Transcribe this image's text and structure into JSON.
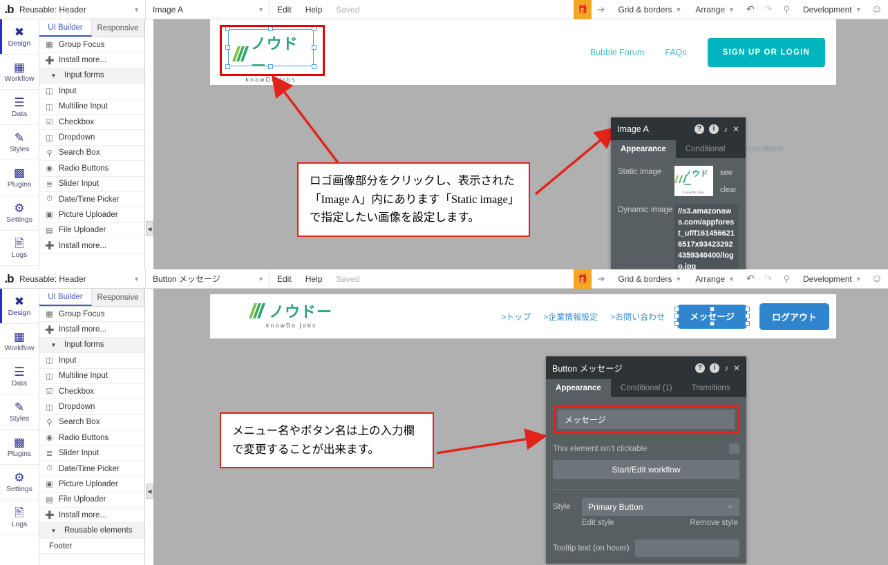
{
  "screens": [
    {
      "id": "screen-top",
      "topbar": {
        "brand": ".b",
        "page_select": "Reusable: Header",
        "element_select": "Image A",
        "edit": "Edit",
        "help": "Help",
        "saved": "Saved",
        "gift_icon": "gift-icon",
        "pointer_icon": "pointer-icon",
        "grid_borders": "Grid & borders",
        "arrange": "Arrange",
        "undo_icon": "undo-icon",
        "redo_icon": "redo-icon",
        "search_icon": "search-icon",
        "version": "Development",
        "avatar_icon": "account-icon"
      },
      "rail": [
        {
          "label": "Design",
          "icon": "design-icon",
          "active": true
        },
        {
          "label": "Workflow",
          "icon": "workflow-icon",
          "active": false
        },
        {
          "label": "Data",
          "icon": "data-icon",
          "active": false
        },
        {
          "label": "Styles",
          "icon": "styles-icon",
          "active": false
        },
        {
          "label": "Plugins",
          "icon": "plugins-icon",
          "active": false
        },
        {
          "label": "Settings",
          "icon": "settings-icon",
          "active": false
        },
        {
          "label": "Logs",
          "icon": "logs-icon",
          "active": false
        }
      ],
      "palette": {
        "tabs": [
          "UI Builder",
          "Responsive"
        ],
        "active_tab": "UI Builder",
        "rows": [
          {
            "label": "Group Focus",
            "icon": "group-focus-icon",
            "type": "item"
          },
          {
            "label": "Install more...",
            "icon": "plus-circle-icon",
            "type": "item"
          },
          {
            "label": "Input forms",
            "icon": "chevron-down-icon",
            "type": "section"
          },
          {
            "label": "Input",
            "icon": "input-icon",
            "type": "item"
          },
          {
            "label": "Multiline Input",
            "icon": "multiline-input-icon",
            "type": "item"
          },
          {
            "label": "Checkbox",
            "icon": "checkbox-icon",
            "type": "item"
          },
          {
            "label": "Dropdown",
            "icon": "dropdown-icon",
            "type": "item"
          },
          {
            "label": "Search Box",
            "icon": "search-icon",
            "type": "item"
          },
          {
            "label": "Radio Buttons",
            "icon": "radio-icon",
            "type": "item"
          },
          {
            "label": "Slider Input",
            "icon": "slider-icon",
            "type": "item"
          },
          {
            "label": "Date/Time Picker",
            "icon": "clock-icon",
            "type": "item"
          },
          {
            "label": "Picture Uploader",
            "icon": "picture-uploader-icon",
            "type": "item"
          },
          {
            "label": "File Uploader",
            "icon": "file-uploader-icon",
            "type": "item"
          },
          {
            "label": "Install more...",
            "icon": "plus-circle-icon",
            "type": "item"
          }
        ]
      },
      "canvas": {
        "logo_main": "ノウドー",
        "logo_sub": "knowDo Jobs",
        "nav": [
          "Bubble Forum",
          "FAQs"
        ],
        "cta": "SIGN UP OR LOGIN",
        "cta_color": "#00b4c0"
      },
      "note": "ロゴ画像部分をクリックし、表示された「Image A」内にあります「Static image」で指定したい画像を設定します。",
      "inspector": {
        "title": "Image A",
        "tabs": [
          "Appearance",
          "Conditional",
          "Transitions"
        ],
        "active_tab": "Appearance",
        "static_image_label": "Static image",
        "see_link": "see",
        "clear_link": "clear",
        "dynamic_image_label": "Dynamic image",
        "dynamic_image_value": "//s3.amazonaws.com/appforest_uf/f1614566216517x934232924359340400/logo.jpg"
      }
    },
    {
      "id": "screen-bottom",
      "topbar": {
        "brand": ".b",
        "page_select": "Reusable: Header",
        "element_select": "Button メッセージ",
        "edit": "Edit",
        "help": "Help",
        "saved": "Saved",
        "gift_icon": "gift-icon",
        "pointer_icon": "pointer-icon",
        "grid_borders": "Grid & borders",
        "arrange": "Arrange",
        "undo_icon": "undo-icon",
        "redo_icon": "redo-icon",
        "search_icon": "search-icon",
        "version": "Development",
        "avatar_icon": "account-icon"
      },
      "rail": [
        {
          "label": "Design",
          "icon": "design-icon",
          "active": true
        },
        {
          "label": "Workflow",
          "icon": "workflow-icon",
          "active": false
        },
        {
          "label": "Data",
          "icon": "data-icon",
          "active": false
        },
        {
          "label": "Styles",
          "icon": "styles-icon",
          "active": false
        },
        {
          "label": "Plugins",
          "icon": "plugins-icon",
          "active": false
        },
        {
          "label": "Settings",
          "icon": "settings-icon",
          "active": false
        },
        {
          "label": "Logs",
          "icon": "logs-icon",
          "active": false
        }
      ],
      "palette": {
        "tabs": [
          "UI Builder",
          "Responsive"
        ],
        "active_tab": "UI Builder",
        "rows": [
          {
            "label": "Group Focus",
            "icon": "group-focus-icon",
            "type": "item"
          },
          {
            "label": "Install more...",
            "icon": "plus-circle-icon",
            "type": "item"
          },
          {
            "label": "Input forms",
            "icon": "chevron-down-icon",
            "type": "section"
          },
          {
            "label": "Input",
            "icon": "input-icon",
            "type": "item"
          },
          {
            "label": "Multiline Input",
            "icon": "multiline-input-icon",
            "type": "item"
          },
          {
            "label": "Checkbox",
            "icon": "checkbox-icon",
            "type": "item"
          },
          {
            "label": "Dropdown",
            "icon": "dropdown-icon",
            "type": "item"
          },
          {
            "label": "Search Box",
            "icon": "search-icon",
            "type": "item"
          },
          {
            "label": "Radio Buttons",
            "icon": "radio-icon",
            "type": "item"
          },
          {
            "label": "Slider Input",
            "icon": "slider-icon",
            "type": "item"
          },
          {
            "label": "Date/Time Picker",
            "icon": "clock-icon",
            "type": "item"
          },
          {
            "label": "Picture Uploader",
            "icon": "picture-uploader-icon",
            "type": "item"
          },
          {
            "label": "File Uploader",
            "icon": "file-uploader-icon",
            "type": "item"
          },
          {
            "label": "Install more...",
            "icon": "plus-circle-icon",
            "type": "item"
          },
          {
            "label": "Reusable elements",
            "icon": "chevron-down-icon",
            "type": "section"
          },
          {
            "label": "Footer",
            "icon": "",
            "type": "plain"
          }
        ]
      },
      "canvas": {
        "logo_main": "ノウドー",
        "logo_sub": "knowDo Jobs",
        "nav": [
          ">トップ",
          ">企業情報設定",
          ">お問い合わせ"
        ],
        "btn_message": "メッセージ",
        "btn_logout": "ログアウト",
        "btn_color": "#2f86ce"
      },
      "note": "メニュー名やボタン名は上の入力欄で変更することが出来ます。",
      "inspector": {
        "title": "Button メッセージ",
        "tabs": [
          "Appearance",
          "Conditional (1)",
          "Transitions"
        ],
        "active_tab": "Appearance",
        "text_value": "メッセージ",
        "not_clickable_label": "This element isn't clickable",
        "workflow_button": "Start/Edit workflow",
        "style_label": "Style",
        "style_value": "Primary Button",
        "edit_style": "Edit style",
        "remove_style": "Remove style",
        "tooltip_label": "Tooltip text (on hover)",
        "tooltip_value": ""
      }
    }
  ]
}
